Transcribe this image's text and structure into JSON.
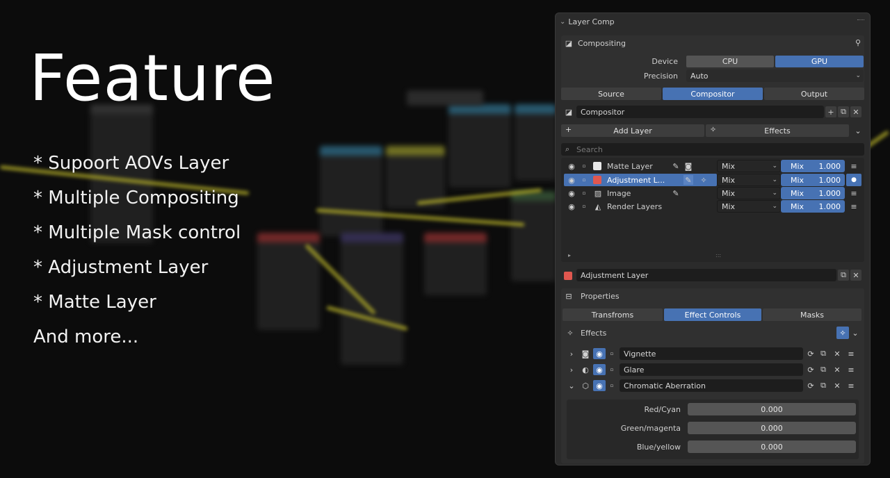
{
  "intro": {
    "title": "Feature",
    "bullets": [
      "* Supoort AOVs Layer",
      "* Multiple Compositing",
      "* Multiple Mask control",
      "* Adjustment Layer",
      "* Matte Layer",
      "And more..."
    ]
  },
  "panel": {
    "title": "Layer Comp",
    "compositing_label": "Compositing",
    "device_label": "Device",
    "device_options": [
      "CPU",
      "GPU"
    ],
    "device_selected": "GPU",
    "precision_label": "Precision",
    "precision_value": "Auto",
    "tabs": [
      "Source",
      "Compositor",
      "Output"
    ],
    "active_tab": "Compositor",
    "compositor_name": "Compositor",
    "add_layer_label": "Add Layer",
    "effects_label": "Effects",
    "search_placeholder": "Search",
    "layers": [
      {
        "name": "Matte Layer",
        "blend": "Mix",
        "mix_label": "Mix",
        "mix_value": "1.000",
        "swatch": "#e8e8e8"
      },
      {
        "name": "Adjustment L...",
        "blend": "Mix",
        "mix_label": "Mix",
        "mix_value": "1.000",
        "swatch": "#e0574f"
      },
      {
        "name": "Image",
        "blend": "Mix",
        "mix_label": "Mix",
        "mix_value": "1.000",
        "swatch": "#cfcfcf"
      },
      {
        "name": "Render Layers",
        "blend": "Mix",
        "mix_label": "Mix",
        "mix_value": "1.000",
        "swatch": "#cfcfcf"
      }
    ],
    "selected_layer_name": "Adjustment Layer",
    "properties_label": "Properties",
    "prop_tabs": [
      "Transfroms",
      "Effect Controls",
      "Masks"
    ],
    "active_prop_tab": "Effect Controls",
    "effects_section_label": "Effects",
    "effects": [
      "Vignette",
      "Glare",
      "Chromatic Aberration"
    ],
    "chromatic": [
      {
        "label": "Red/Cyan",
        "value": "0.000"
      },
      {
        "label": "Green/magenta",
        "value": "0.000"
      },
      {
        "label": "Blue/yellow",
        "value": "0.000"
      }
    ],
    "colors": {
      "accent": "#4772b3",
      "panel": "#2b2b2b",
      "adjust_swatch": "#e0574f"
    }
  }
}
